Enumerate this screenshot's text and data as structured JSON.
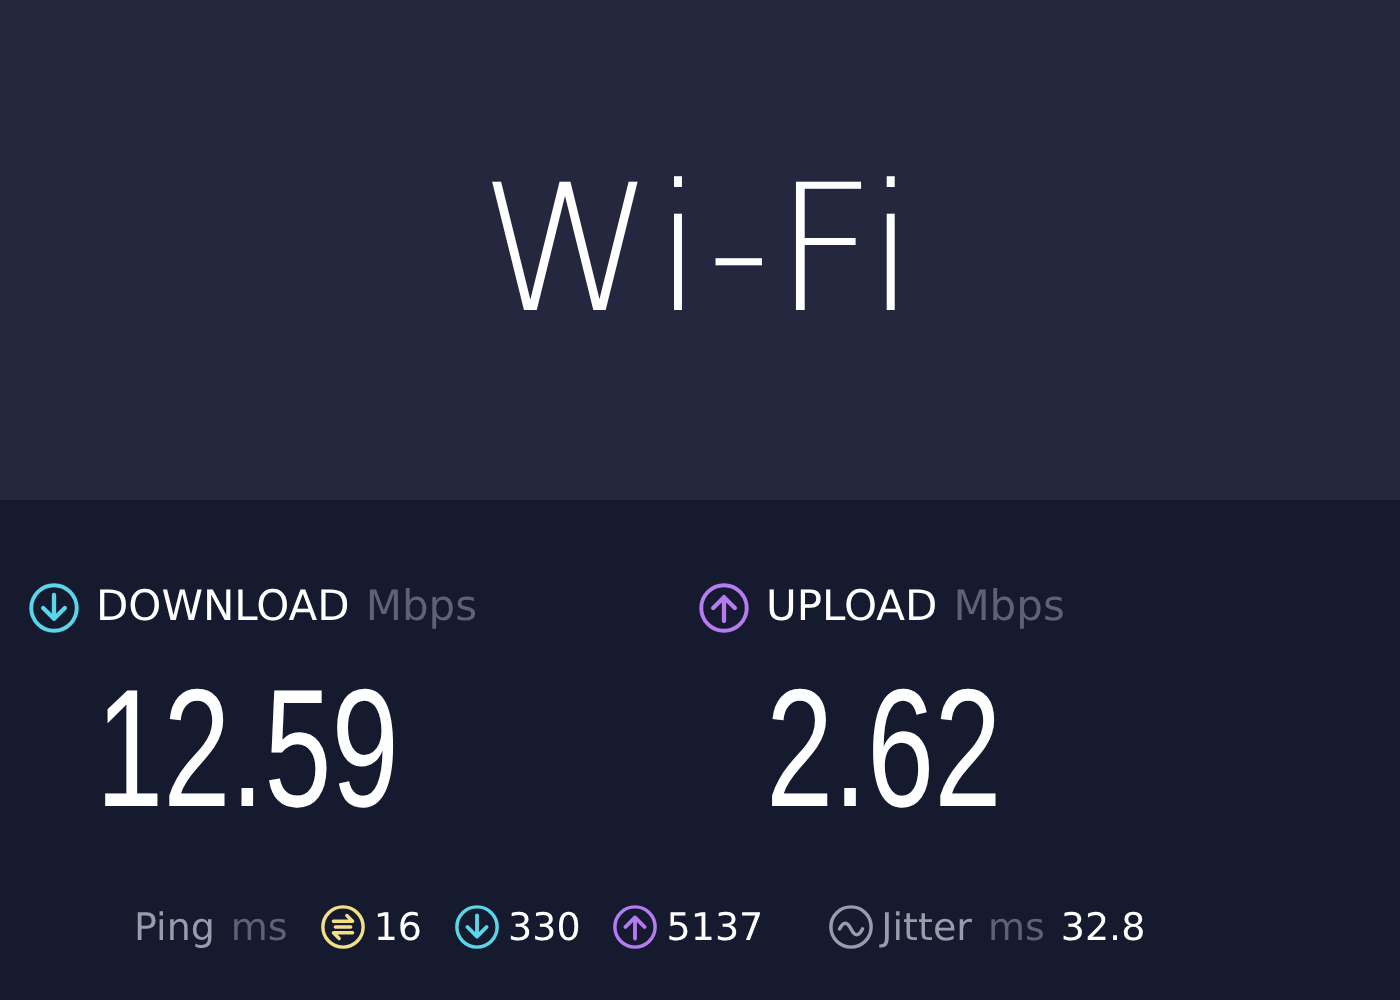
{
  "title": "Wi-Fi",
  "metrics": [
    {
      "kind": "download",
      "label": "DOWNLOAD",
      "unit": "Mbps",
      "value": "12.59",
      "color": "#5ad6e8"
    },
    {
      "kind": "upload",
      "label": "UPLOAD",
      "unit": "Mbps",
      "value": "2.62",
      "color": "#b57cf2"
    }
  ],
  "ping": {
    "label": "Ping",
    "unit": "ms",
    "items": [
      {
        "kind": "idle",
        "value": "16",
        "color": "#f2df86"
      },
      {
        "kind": "download",
        "value": "330",
        "color": "#5ad6e8"
      },
      {
        "kind": "upload",
        "value": "5137",
        "color": "#b57cf2"
      }
    ]
  },
  "jitter": {
    "label": "Jitter",
    "unit": "ms",
    "value": "32.8"
  }
}
